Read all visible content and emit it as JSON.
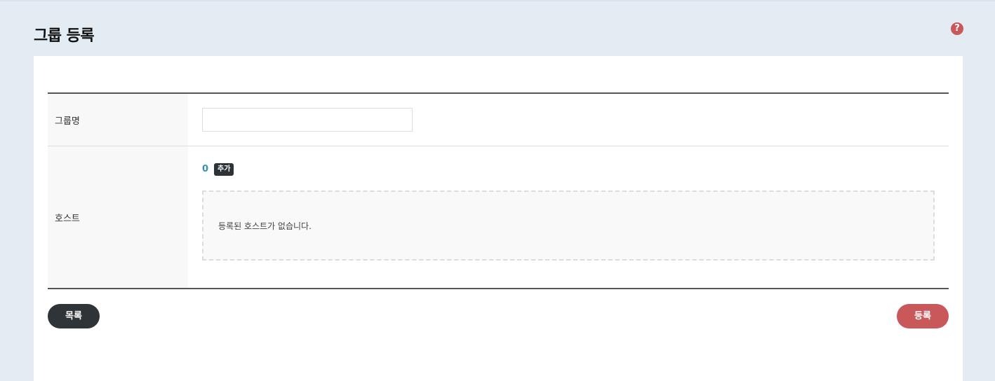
{
  "page": {
    "title": "그룹 등록",
    "help_icon": "?"
  },
  "form": {
    "name_label": "그룹명",
    "name_value": "",
    "name_placeholder": "",
    "host_label": "호스트",
    "host_count": "0",
    "add_button_label": "추가",
    "host_empty_message": "등록된 호스트가 없습니다."
  },
  "actions": {
    "list_label": "목록",
    "register_label": "등록"
  },
  "colors": {
    "background": "#e3ebf3",
    "accent_red": "#c9585a",
    "dark_button": "#2f3439",
    "count_blue": "#3b8fb0"
  },
  "icons": {
    "help": "question-circle-icon"
  }
}
